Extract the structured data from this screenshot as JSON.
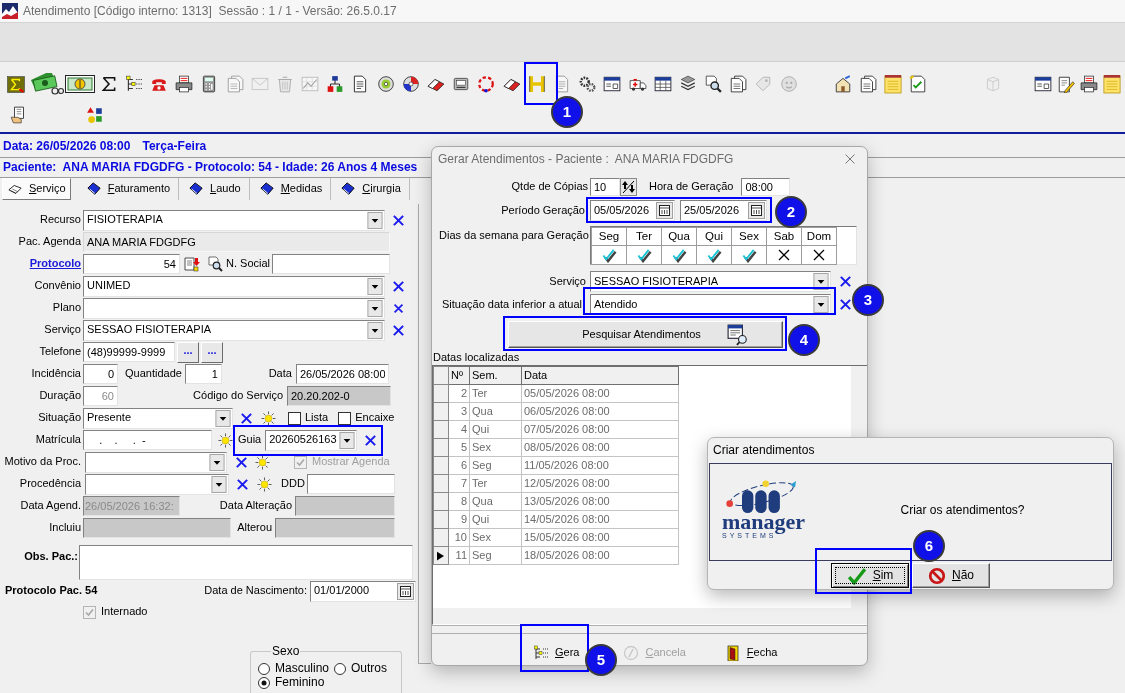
{
  "window": {
    "title": "Atendimento [Código interno: 1313]  Sessão : 1 / 1 - Versão: 26.5.0.17"
  },
  "toolbar": {
    "rows": [
      {
        "groups": [
          {
            "buttons": [
              {
                "disabled": false
              },
              {
                "disabled": false
              },
              {
                "disabled": false
              },
              {
                "disabled": false
              },
              {
                "disabled": false
              },
              {
                "disabled": false
              },
              {
                "disabled": false
              },
              {
                "disabled": false
              },
              {
                "disabled": true
              },
              {
                "disabled": true
              },
              {
                "disabled": true
              },
              {
                "disabled": true
              },
              {
                "disabled": false
              },
              {
                "disabled": false
              },
              {
                "disabled": false
              },
              {
                "disabled": false
              },
              {
                "disabled": false
              },
              {
                "disabled": false
              },
              {
                "disabled": false
              },
              {
                "disabled": false
              },
              {
                "disabled": false
              },
              {
                "disabled": true
              },
              {
                "disabled": false
              },
              {
                "disabled": false
              },
              {
                "disabled": false
              },
              {
                "disabled": false
              },
              {
                "disabled": false
              },
              {
                "disabled": false
              },
              {
                "disabled": false
              },
              {
                "disabled": true
              },
              {
                "disabled": true
              }
            ]
          },
          {
            "buttons": [
              {
                "disabled": false
              },
              {
                "disabled": false
              },
              {
                "disabled": false
              },
              {
                "disabled": false
              }
            ]
          },
          {
            "buttons": [
              {
                "disabled": true
              }
            ]
          },
          {
            "buttons": [
              {
                "disabled": false
              },
              {
                "disabled": false
              },
              {
                "disabled": false
              },
              {
                "disabled": false
              }
            ]
          }
        ]
      },
      {
        "groups": [
          {
            "buttons": [
              {
                "disabled": false
              }
            ]
          },
          {
            "buttons": [
              {
                "disabled": false
              }
            ]
          }
        ]
      }
    ]
  },
  "date_line": {
    "text": "Data: 26/05/2026 08:00",
    "weekday": "Terça-Feira"
  },
  "patient_line": "Paciente:  ANA MARIA FDGDFG - Protocolo: 54 - Idade: 26 Anos 4 Meses",
  "tabs": [
    {
      "label": "Serviço",
      "selected": true
    },
    {
      "label": "Faturamento",
      "selected": false
    },
    {
      "label": "Laudo",
      "selected": false
    },
    {
      "label": "Medidas",
      "selected": false
    },
    {
      "label": "Cirurgia",
      "selected": false
    }
  ],
  "form": {
    "recurso": {
      "label": "Recurso",
      "value": "FISIOTERAPIA"
    },
    "pac_agenda": {
      "label": "Pac. Agenda",
      "value": "ANA MARIA FDGDFG"
    },
    "protocolo": {
      "label": "Protocolo",
      "value": "54"
    },
    "nome_social": {
      "label": "N. Social"
    },
    "convenio": {
      "label": "Convênio",
      "value": "UNIMED"
    },
    "plano": {
      "label": "Plano"
    },
    "servico": {
      "label": "Serviço",
      "value": "SESSAO FISIOTERAPIA"
    },
    "telefone": {
      "label": "Telefone",
      "value": "(48)99999-9999",
      "buttons": [
        "...",
        "..."
      ]
    },
    "incidencia": {
      "label": "Incidência",
      "value": "0"
    },
    "quantidade": {
      "label": "Quantidade",
      "value": "1"
    },
    "data": {
      "label": "Data",
      "value": "26/05/2026 08:00"
    },
    "duracao": {
      "label": "Duração",
      "value": "60",
      "disabled": true
    },
    "codigo_servico": {
      "label": "Código do Serviço",
      "value": "20.20.202-0",
      "readonly": true
    },
    "situacao": {
      "label": "Situação",
      "value": "Presente"
    },
    "lista": {
      "label": "Lista",
      "checked": false
    },
    "encaixe": {
      "label": "Encaixe",
      "checked": false
    },
    "matricula": {
      "label": "Matrícula",
      "value": "    .    .     .  -"
    },
    "guia": {
      "label": "Guia",
      "value": "20260526163",
      "highlighted": true
    },
    "motivo": {
      "label": "Motivo da Proc."
    },
    "mostrar_agenda": {
      "label": "Mostrar Agenda",
      "checked": true,
      "disabled": true
    },
    "procedencia": {
      "label": "Procedência"
    },
    "ddd": {
      "label": "DDD"
    },
    "data_agend": {
      "label": "Data Agend.",
      "value": "26/05/2026 16:32:",
      "readonly": true,
      "disabled": true
    },
    "data_alteracao": {
      "label": "Data Alteração",
      "readonly": true
    },
    "incluiu": {
      "label": "Incluiu",
      "readonly": true
    },
    "alterou": {
      "label": "Alterou",
      "readonly": true
    },
    "obs": {
      "label": "Obs. Pac.:"
    },
    "protocolo_pac": "Protocolo Pac. 54",
    "nascimento": {
      "label": "Data de Nascimento:",
      "value": "01/01/2000"
    },
    "internado": {
      "label": "Internado",
      "checked": true,
      "disabled": true
    },
    "sexo": {
      "label": "Sexo",
      "options": [
        {
          "label": "Masculino",
          "selected": false
        },
        {
          "label": "Outros",
          "selected": false
        },
        {
          "label": "Feminino",
          "selected": true
        }
      ]
    }
  },
  "dialog": {
    "title": "Gerar Atendimentos - Paciente :  ANA MARIA FDGDFG",
    "copies": {
      "label": "Qtde de Cópias",
      "value": "10"
    },
    "hour": {
      "label": "Hora de Geração",
      "value": "08:00"
    },
    "period": {
      "label": "Período Geração",
      "from": "05/05/2026",
      "to": "25/05/2026"
    },
    "weekdays": {
      "label": "Dias da semana para Geração",
      "days": [
        {
          "label": "Seg",
          "checked": true
        },
        {
          "label": "Ter",
          "checked": true
        },
        {
          "label": "Qua",
          "checked": true
        },
        {
          "label": "Qui",
          "checked": true
        },
        {
          "label": "Sex",
          "checked": true
        },
        {
          "label": "Sab",
          "checked": false
        },
        {
          "label": "Dom",
          "checked": false
        }
      ]
    },
    "service": {
      "label": "Serviço",
      "value": "SESSAO FISIOTERAPIA"
    },
    "situation": {
      "label": "Situação data inferior a atual",
      "value": "Atendido"
    },
    "search_button": "Pesquisar Atendimentos",
    "results": {
      "label": "Datas localizadas",
      "columns": [
        "Nº",
        "Sem.",
        "Data"
      ],
      "rows": [
        {
          "number": "2",
          "weekday": "Ter",
          "date": "05/05/2026 08:00",
          "selected": false
        },
        {
          "number": "3",
          "weekday": "Qua",
          "date": "06/05/2026 08:00",
          "selected": false
        },
        {
          "number": "4",
          "weekday": "Qui",
          "date": "07/05/2026 08:00",
          "selected": false
        },
        {
          "number": "5",
          "weekday": "Sex",
          "date": "08/05/2026 08:00",
          "selected": false
        },
        {
          "number": "6",
          "weekday": "Seg",
          "date": "11/05/2026 08:00",
          "selected": false
        },
        {
          "number": "7",
          "weekday": "Ter",
          "date": "12/05/2026 08:00",
          "selected": false
        },
        {
          "number": "8",
          "weekday": "Qua",
          "date": "13/05/2026 08:00",
          "selected": false
        },
        {
          "number": "9",
          "weekday": "Qui",
          "date": "14/05/2026 08:00",
          "selected": false
        },
        {
          "number": "10",
          "weekday": "Sex",
          "date": "15/05/2026 08:00",
          "selected": false
        },
        {
          "number": "11",
          "weekday": "Seg",
          "date": "18/05/2026 08:00",
          "selected": true
        }
      ]
    },
    "buttons": [
      {
        "label": "Gera",
        "disabled": false
      },
      {
        "label": "Cancela",
        "disabled": true
      },
      {
        "label": "Fecha",
        "disabled": false
      }
    ]
  },
  "confirm": {
    "title": "Criar atendimentos",
    "logo": {
      "name": "manager",
      "tagline": "SYSTEMS"
    },
    "message": "Criar os atendimentos?",
    "buttons": [
      {
        "label": "Sim",
        "focused": true
      },
      {
        "label": "Não",
        "focused": false
      }
    ]
  },
  "callouts": [
    {
      "number": "1"
    },
    {
      "number": "2"
    },
    {
      "number": "3"
    },
    {
      "number": "4"
    },
    {
      "number": "5"
    },
    {
      "number": "6"
    }
  ]
}
